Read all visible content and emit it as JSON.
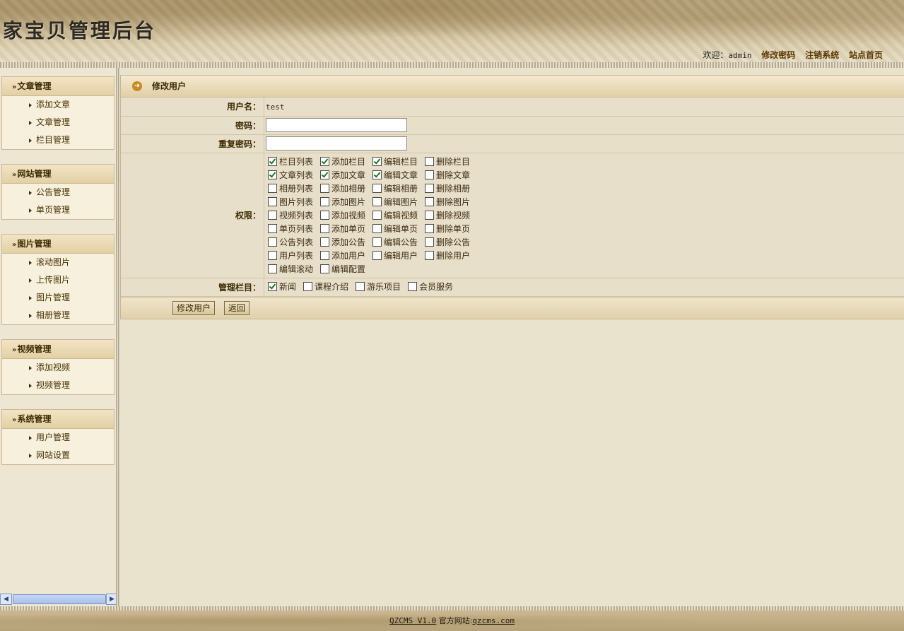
{
  "header": {
    "logo": "家宝贝管理后台",
    "welcome": "欢迎：",
    "username": "admin",
    "links": [
      "修改密码",
      "注销系统",
      "站点首页"
    ]
  },
  "sidebar": {
    "menus": [
      {
        "title": "文章管理",
        "items": [
          "添加文章",
          "文章管理",
          "栏目管理"
        ]
      },
      {
        "title": "网站管理",
        "items": [
          "公告管理",
          "单页管理"
        ]
      },
      {
        "title": "图片管理",
        "items": [
          "滚动图片",
          "上传图片",
          "图片管理",
          "相册管理"
        ]
      },
      {
        "title": "视频管理",
        "items": [
          "添加视频",
          "视频管理"
        ]
      },
      {
        "title": "系统管理",
        "items": [
          "用户管理",
          "网站设置"
        ]
      }
    ]
  },
  "panel": {
    "title": "修改用户",
    "username_label": "用户名：",
    "username_value": "test",
    "password_label": "密码：",
    "password_value": "",
    "repeat_label": "重复密码：",
    "repeat_value": "",
    "perm_label": "权限：",
    "permissions": [
      [
        {
          "label": "栏目列表",
          "checked": true
        },
        {
          "label": "添加栏目",
          "checked": true
        },
        {
          "label": "编辑栏目",
          "checked": true
        },
        {
          "label": "删除栏目",
          "checked": false
        }
      ],
      [
        {
          "label": "文章列表",
          "checked": true
        },
        {
          "label": "添加文章",
          "checked": true
        },
        {
          "label": "编辑文章",
          "checked": true
        },
        {
          "label": "删除文章",
          "checked": false
        }
      ],
      [
        {
          "label": "相册列表",
          "checked": false
        },
        {
          "label": "添加相册",
          "checked": false
        },
        {
          "label": "编辑相册",
          "checked": false
        },
        {
          "label": "删除相册",
          "checked": false
        }
      ],
      [
        {
          "label": "图片列表",
          "checked": false
        },
        {
          "label": "添加图片",
          "checked": false
        },
        {
          "label": "编辑图片",
          "checked": false
        },
        {
          "label": "删除图片",
          "checked": false
        }
      ],
      [
        {
          "label": "视频列表",
          "checked": false
        },
        {
          "label": "添加视频",
          "checked": false
        },
        {
          "label": "编辑视频",
          "checked": false
        },
        {
          "label": "删除视频",
          "checked": false
        }
      ],
      [
        {
          "label": "单页列表",
          "checked": false
        },
        {
          "label": "添加单页",
          "checked": false
        },
        {
          "label": "编辑单页",
          "checked": false
        },
        {
          "label": "删除单页",
          "checked": false
        }
      ],
      [
        {
          "label": "公告列表",
          "checked": false
        },
        {
          "label": "添加公告",
          "checked": false
        },
        {
          "label": "编辑公告",
          "checked": false
        },
        {
          "label": "删除公告",
          "checked": false
        }
      ],
      [
        {
          "label": "用户列表",
          "checked": false
        },
        {
          "label": "添加用户",
          "checked": false
        },
        {
          "label": "编辑用户",
          "checked": false
        },
        {
          "label": "删除用户",
          "checked": false
        }
      ],
      [
        {
          "label": "编辑滚动",
          "checked": false
        },
        {
          "label": "编辑配置",
          "checked": false
        }
      ]
    ],
    "column_label": "管理栏目：",
    "columns": [
      {
        "label": "新闻",
        "checked": true
      },
      {
        "label": "课程介绍",
        "checked": false
      },
      {
        "label": "游乐项目",
        "checked": false
      },
      {
        "label": "会员服务",
        "checked": false
      }
    ],
    "submit_label": "修改用户",
    "back_label": "返回"
  },
  "footer": {
    "brand": "QZCMS  V1.0",
    "official": "官方网站:",
    "site": "qzcms.com"
  }
}
